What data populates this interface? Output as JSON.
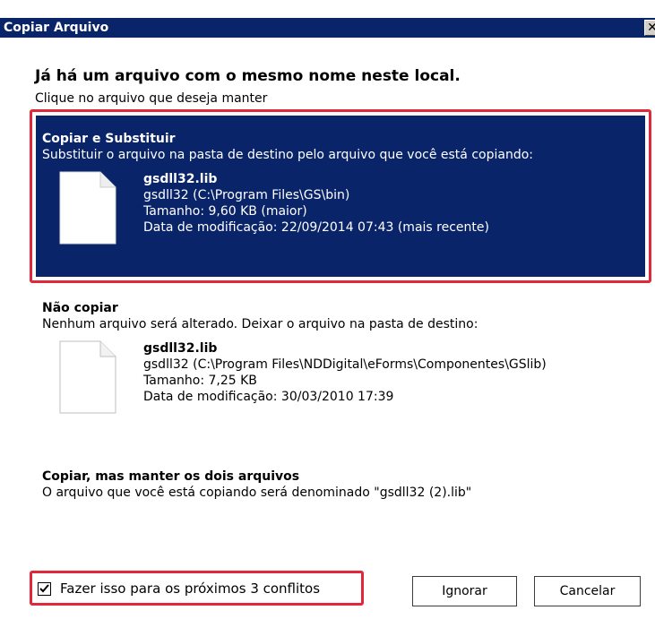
{
  "window": {
    "title": "Copiar Arquivo",
    "close_glyph": "✕"
  },
  "heading": "Já há um arquivo com o mesmo nome neste local.",
  "subheading": "Clique no arquivo que deseja manter",
  "options": {
    "replace": {
      "title": "Copiar e Substituir",
      "description": "Substituir o arquivo na pasta de destino pelo arquivo que você está copiando:",
      "file": {
        "name": "gsdll32.lib",
        "path": "gsdll32 (C:\\Program Files\\GS\\bin)",
        "size": "Tamanho: 9,60 KB (maior)",
        "modified": "Data de modificação: 22/09/2014 07:43 (mais recente)"
      },
      "selected": true
    },
    "skip": {
      "title": "Não copiar",
      "description": "Nenhum arquivo será alterado. Deixar o arquivo na pasta de destino:",
      "file": {
        "name": "gsdll32.lib",
        "path": "gsdll32 (C:\\Program Files\\NDDigital\\eForms\\Componentes\\GSlib)",
        "size": "Tamanho: 7,25 KB",
        "modified": "Data de modificação: 30/03/2010 17:39"
      }
    },
    "keep_both": {
      "title": "Copiar, mas manter os dois arquivos",
      "description": "O arquivo que você está copiando será denominado \"gsdll32 (2).lib\""
    }
  },
  "footer": {
    "checkbox_label": "Fazer isso para os próximos 3 conflitos",
    "checkbox_checked": true,
    "ignore_label": "Ignorar",
    "cancel_label": "Cancelar"
  },
  "colors": {
    "selection": "#0a246a",
    "annotation_red": "#e0283a"
  },
  "icons": {
    "file": "document-file-icon",
    "close": "close-icon",
    "check": "checkmark-icon"
  }
}
